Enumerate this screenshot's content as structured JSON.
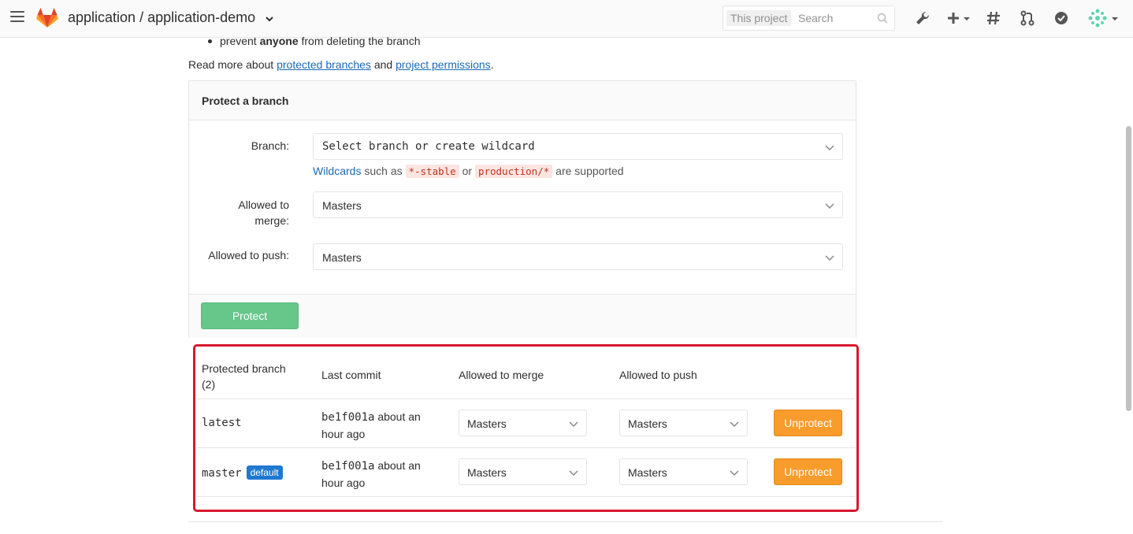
{
  "header": {
    "project_title": "application / application-demo",
    "search_scope": "This project",
    "search_placeholder": "Search"
  },
  "intro": {
    "bullet_prefix": "prevent",
    "bullet_bold": "anyone",
    "bullet_suffix": "from deleting the branch",
    "readmore_prefix": "Read more about",
    "link_protected_branches": "protected branches",
    "readmore_and": "and",
    "link_project_permissions": "project permissions",
    "readmore_end": "."
  },
  "protect_form": {
    "title": "Protect a branch",
    "branch_label": "Branch:",
    "branch_placeholder": "Select branch or create wildcard",
    "hint_link": "Wildcards",
    "hint_text1": "such as",
    "hint_code1": "*-stable",
    "hint_or": "or",
    "hint_code2": "production/*",
    "hint_text2": "are supported",
    "merge_label_line1": "Allowed to",
    "merge_label_line2": "merge:",
    "merge_value": "Masters",
    "push_label": "Allowed to push:",
    "push_value": "Masters",
    "protect_button": "Protect"
  },
  "table": {
    "col_branch_line1": "Protected branch",
    "col_branch_line2": "(2)",
    "col_commit": "Last commit",
    "col_merge": "Allowed to merge",
    "col_push": "Allowed to push",
    "rows": [
      {
        "branch": "latest",
        "commit_sha": "be1f001a",
        "commit_time_line1": "about an",
        "commit_time_line2": "hour ago",
        "merge": "Masters",
        "push": "Masters",
        "action": "Unprotect"
      },
      {
        "branch": "master",
        "badge": "default",
        "commit_sha": "be1f001a",
        "commit_time_line1": "about an",
        "commit_time_line2": "hour ago",
        "merge": "Masters",
        "push": "Masters",
        "action": "Unprotect"
      }
    ]
  },
  "colors": {
    "link": "#1b69b6",
    "protect_button": "#67c68a",
    "unprotect_button": "#f89c2c",
    "highlight_border": "#d9182e",
    "default_badge": "#1f78d1"
  }
}
